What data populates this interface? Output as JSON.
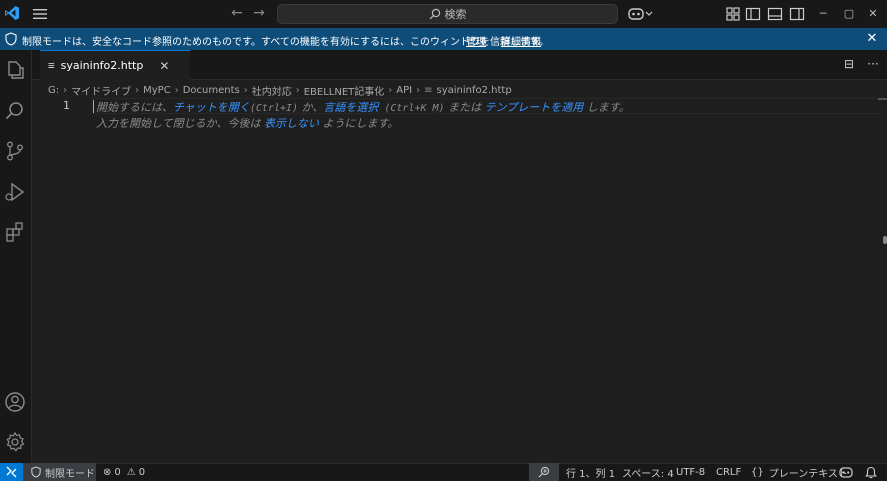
{
  "title_bar": {
    "search_label": "検索",
    "nav_back": "←",
    "nav_forward": "→",
    "window_minimize": "─",
    "window_maximize": "▢",
    "window_close": "✕"
  },
  "banner": {
    "message": "制限モードは、安全なコード参照のためのものです。すべての機能を有効にするには、このウィンドウを信頼します。",
    "manage_link": "管理",
    "details_link": "詳細情報",
    "close": "✕"
  },
  "tab": {
    "label": "syaininfo2.http",
    "file_icon": "≡",
    "close": "✕",
    "split_icon": "⊟",
    "more_icon": "···"
  },
  "breadcrumb": [
    "G:",
    "マイドライブ",
    "MyPC",
    "Documents",
    "社内対応",
    "EBELLNET記事化",
    "API",
    "syaininfo2.http"
  ],
  "breadcrumb_file_icon": "≡",
  "editor": {
    "line_number": "1",
    "hint_line1": {
      "p1": "開始するには、",
      "chat_link": "チャットを開く",
      "chat_key": "(Ctrl+I)",
      "p2": " か、",
      "lang_link": "言語を選択",
      "lang_key": " (Ctrl+K M)",
      "p3": " または ",
      "template_link": "テンプレートを適用",
      "p4": " します。"
    },
    "hint_line2": {
      "p1": "入力を開始して閉じるか、今後は ",
      "dont_show_link": "表示しない",
      "p2": " ようにします。"
    }
  },
  "status_bar": {
    "restricted_mode": "制限モード",
    "errors": "0",
    "warnings": "0",
    "position": "行 1、列 1",
    "spaces": "スペース: 4",
    "encoding": "UTF-8",
    "eol": "CRLF",
    "language_braces": "{}",
    "language": "プレーンテキスト"
  },
  "colors": {
    "accent": "#0078d4",
    "banner": "#0e4c7a",
    "link": "#3794ff",
    "background": "#1f1f1f",
    "chrome": "#181818"
  }
}
